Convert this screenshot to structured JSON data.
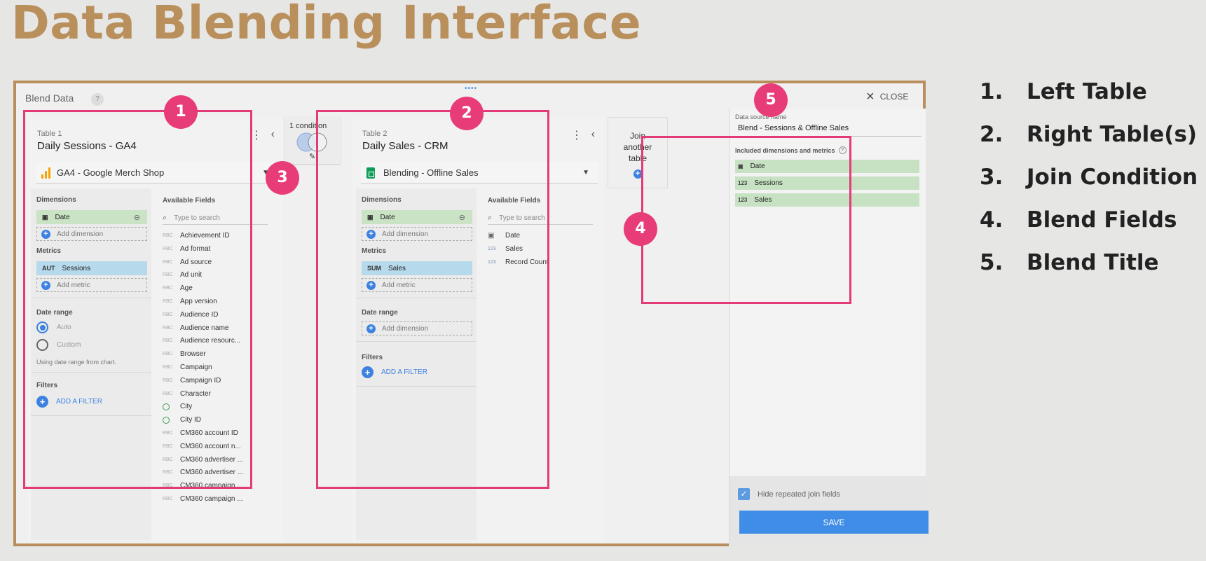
{
  "page_title": "Data Blending Interface",
  "dialog": {
    "title": "Blend Data",
    "help": "?",
    "drag_handle": "••••",
    "close_label": "CLOSE"
  },
  "table1": {
    "label": "Table 1",
    "name": "Daily Sessions - GA4",
    "source": "GA4 - Google Merch Shop",
    "dimensions_label": "Dimensions",
    "dimension_chip": "Date",
    "add_dimension": "Add dimension",
    "metrics_label": "Metrics",
    "metric_chip_icon": "AUT",
    "metric_chip": "Sessions",
    "add_metric": "Add metric",
    "date_range_label": "Date range",
    "radio_auto": "Auto",
    "radio_custom": "Custom",
    "date_note": "Using date range from chart.",
    "filters_label": "Filters",
    "add_filter": "ADD A FILTER",
    "available_fields_label": "Available Fields",
    "search_placeholder": "Type to search",
    "fields": [
      {
        "icon": "RBC",
        "name": "Achievement ID"
      },
      {
        "icon": "RBC",
        "name": "Ad format"
      },
      {
        "icon": "RBC",
        "name": "Ad source"
      },
      {
        "icon": "RBC",
        "name": "Ad unit"
      },
      {
        "icon": "RBC",
        "name": "Age"
      },
      {
        "icon": "RBC",
        "name": "App version"
      },
      {
        "icon": "RBC",
        "name": "Audience ID"
      },
      {
        "icon": "RBC",
        "name": "Audience name"
      },
      {
        "icon": "RBC",
        "name": "Audience resourc..."
      },
      {
        "icon": "RBC",
        "name": "Browser"
      },
      {
        "icon": "RBC",
        "name": "Campaign"
      },
      {
        "icon": "RBC",
        "name": "Campaign ID"
      },
      {
        "icon": "RBC",
        "name": "Character"
      },
      {
        "icon": "globe",
        "name": "City"
      },
      {
        "icon": "globe",
        "name": "City ID"
      },
      {
        "icon": "RBC",
        "name": "CM360 account ID"
      },
      {
        "icon": "RBC",
        "name": "CM360 account n..."
      },
      {
        "icon": "RBC",
        "name": "CM360 advertiser ..."
      },
      {
        "icon": "RBC",
        "name": "CM360 advertiser ..."
      },
      {
        "icon": "RBC",
        "name": "CM360 campaign ..."
      },
      {
        "icon": "RBC",
        "name": "CM360 campaign ..."
      }
    ]
  },
  "join_condition": {
    "label": "1 condition"
  },
  "table2": {
    "label": "Table 2",
    "name": "Daily Sales - CRM",
    "source": "Blending - Offline Sales",
    "dimensions_label": "Dimensions",
    "dimension_chip": "Date",
    "add_dimension": "Add dimension",
    "metrics_label": "Metrics",
    "metric_chip_icon": "SUM",
    "metric_chip": "Sales",
    "add_metric": "Add metric",
    "date_range_label": "Date range",
    "date_add_dimension": "Add dimension",
    "filters_label": "Filters",
    "add_filter": "ADD A FILTER",
    "available_fields_label": "Available Fields",
    "search_placeholder": "Type to search",
    "fields": [
      {
        "icon": "cal",
        "name": "Date"
      },
      {
        "icon": "123",
        "name": "Sales"
      },
      {
        "icon": "123",
        "name": "Record Count"
      }
    ]
  },
  "join_another": {
    "line1": "Join",
    "line2": "another",
    "line3": "table"
  },
  "blend_panel": {
    "source_name_label": "Data source name",
    "source_name": "Blend - Sessions & Offline Sales",
    "included_label": "Included dimensions and metrics",
    "fields": [
      {
        "icon": "cal",
        "name": "Date"
      },
      {
        "icon": "123",
        "name": "Sessions"
      },
      {
        "icon": "123",
        "name": "Sales"
      }
    ],
    "hide_repeated": "Hide repeated join fields",
    "save_label": "SAVE"
  },
  "badges": [
    "1",
    "2",
    "3",
    "4",
    "5"
  ],
  "legend": [
    {
      "num": "1.",
      "text": "Left Table"
    },
    {
      "num": "2.",
      "text": "Right Table(s)"
    },
    {
      "num": "3.",
      "text": "Join Condition"
    },
    {
      "num": "4.",
      "text": "Blend Fields"
    },
    {
      "num": "5.",
      "text": "Blend Title"
    }
  ],
  "colors": {
    "title": "#b98f5c",
    "highlight": "#e33a78",
    "badge": "#e83c78",
    "dimension_chip": "#c9e3c4",
    "metric_chip": "#b7d9ec",
    "accent_blue": "#3f8de6"
  }
}
